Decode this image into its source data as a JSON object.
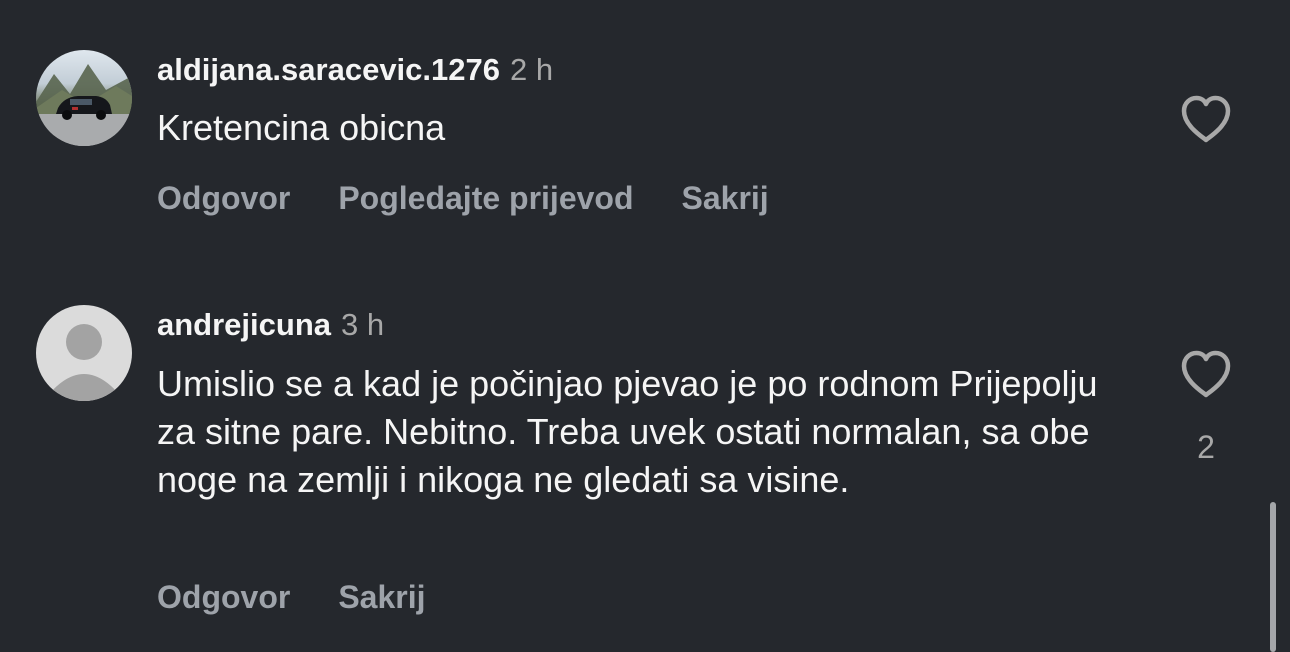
{
  "comments": [
    {
      "username": "aldijana.saracevic.1276",
      "time": "2 h",
      "text": "Kretencina obicna",
      "avatar": "photo-avatar-car",
      "actions": [
        "Odgovor",
        "Pogledajte prijevod",
        "Sakrij"
      ],
      "likes": ""
    },
    {
      "username": "andrejicuna",
      "time": "3 h",
      "text": "Umislio se a kad je počinjao pjevao je po rodnom Prijepolju za sitne pare.  Nebitno. Treba uvek ostati normalan, sa obe noge na zemlji i nikoga ne gledati sa visine.",
      "avatar": "default-avatar-icon",
      "actions": [
        "Odgovor",
        "Sakrij"
      ],
      "likes": "2"
    }
  ],
  "colors": {
    "background": "#25282d",
    "primary_text": "#f5f5f5",
    "secondary_text": "#a8a8a8",
    "action_text": "#9ea3aa"
  }
}
